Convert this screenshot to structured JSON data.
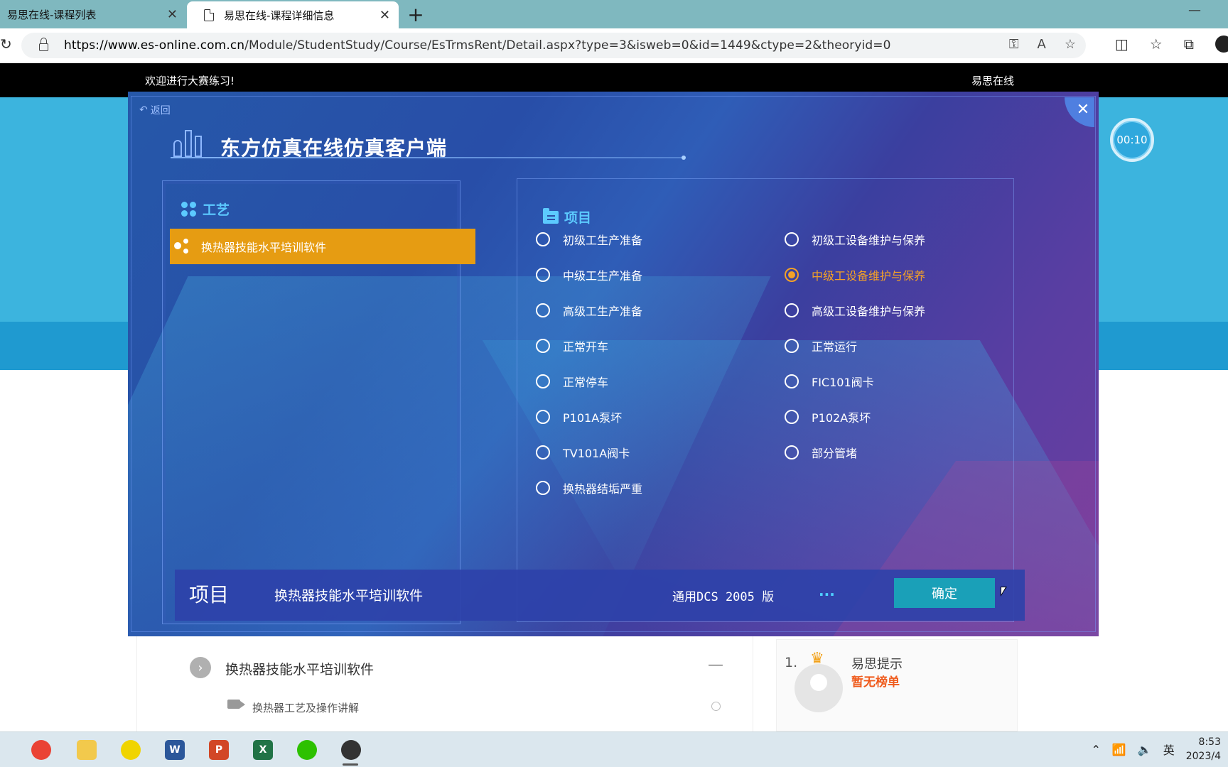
{
  "browser": {
    "tabs": [
      {
        "title": "易思在线-课程列表",
        "active": false
      },
      {
        "title": "易思在线-课程详细信息",
        "active": true
      }
    ],
    "url_host": "https://www.es-online.com.cn",
    "url_path": "/Module/StudentStudy/Course/EsTrmsRent/Detail.aspx?type=3&isweb=0&id=1449&ctype=2&theoryid=0"
  },
  "page": {
    "welcome": "欢迎进行大赛练习!",
    "brand": "易思在线",
    "timer": "00:10",
    "course_title": "换热器技能水平培训软件",
    "lesson_title": "换热器工艺及操作讲解",
    "rank": {
      "number": "1.",
      "name": "易思提示",
      "status": "暂无榜单"
    }
  },
  "modal": {
    "back_label": "返回",
    "title": "东方仿真在线仿真客户端",
    "left_panel": {
      "title": "工艺",
      "items": [
        {
          "label": "换热器技能水平培训软件",
          "selected": true
        }
      ]
    },
    "right_panel": {
      "title": "项目",
      "options": [
        {
          "label": "初级工生产准备",
          "selected": false
        },
        {
          "label": "初级工设备维护与保养",
          "selected": false
        },
        {
          "label": "中级工生产准备",
          "selected": false
        },
        {
          "label": "中级工设备维护与保养",
          "selected": true
        },
        {
          "label": "高级工生产准备",
          "selected": false
        },
        {
          "label": "高级工设备维护与保养",
          "selected": false
        },
        {
          "label": "正常开车",
          "selected": false
        },
        {
          "label": "正常运行",
          "selected": false
        },
        {
          "label": "正常停车",
          "selected": false
        },
        {
          "label": "FIC101阀卡",
          "selected": false
        },
        {
          "label": "P101A泵坏",
          "selected": false
        },
        {
          "label": "P102A泵坏",
          "selected": false
        },
        {
          "label": "TV101A阀卡",
          "selected": false
        },
        {
          "label": "部分管堵",
          "selected": false
        },
        {
          "label": "换热器结垢严重",
          "selected": false
        }
      ]
    },
    "footer": {
      "label": "项目",
      "process": "换热器技能水平培训软件",
      "version": "通用DCS 2005 版",
      "more": "...",
      "confirm": "确定"
    }
  },
  "taskbar": {
    "ime": "英",
    "time": "8:53",
    "date": "2023/4"
  },
  "colors": {
    "accent_orange": "#e69c12",
    "selected_option": "#f4a127",
    "panel_title": "#5ccaff",
    "confirm_button": "#1aa0b8"
  }
}
